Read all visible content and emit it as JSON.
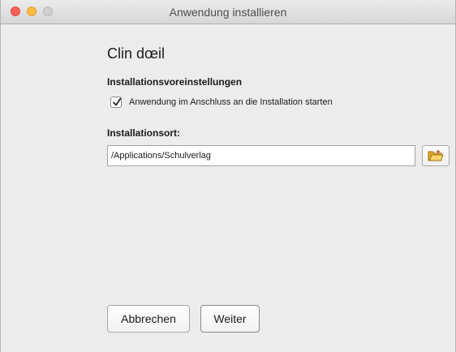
{
  "window": {
    "title": "Anwendung installieren"
  },
  "app": {
    "name": "Clin dœil"
  },
  "settings": {
    "heading": "Installationsvoreinstellungen",
    "launch_after_install": {
      "label": "Anwendung im Anschluss an die Installation starten",
      "checked": true
    }
  },
  "location": {
    "heading": "Installationsort:",
    "path": "/Applications/Schulverlag"
  },
  "buttons": {
    "cancel_label": "Abbrechen",
    "next_label": "Weiter"
  },
  "icons": {
    "traffic_lights": [
      "close-icon",
      "minimize-icon",
      "zoom-icon"
    ],
    "checkbox": "checkmark-icon",
    "browse": "folder-open-icon"
  },
  "colors": {
    "close": "#fc605b",
    "minimize": "#fdbc40",
    "zoom_disabled": "#d0d0d0",
    "folder": "#f2c94c"
  }
}
